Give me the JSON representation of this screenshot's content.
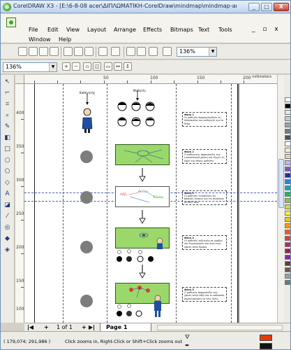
{
  "window": {
    "title": "CorelDRAW X3 - [E:\\6-8-08 acer\\ΔΙΠΛΩΜΑΤΙΚΗ-CorelDraw\\mindmap\\mindmap-anaparasta...",
    "min_label": "_",
    "max_label": "□",
    "close_label": "X"
  },
  "menu": {
    "file": "File",
    "edit": "Edit",
    "view": "View",
    "layout": "Layout",
    "arrange": "Arrange",
    "effects": "Effects",
    "bitmaps": "Bitmaps",
    "text": "Text",
    "tools": "Tools",
    "window": "Window",
    "help": "Help",
    "mdi": "_ ▫ x"
  },
  "toolbar": {
    "zoom_value": "136%"
  },
  "propbar": {
    "zoom_value": "136%"
  },
  "ruler": {
    "top_marks": [
      "50",
      "100",
      "150",
      "200"
    ],
    "unit": "millimeters",
    "left_marks": [
      "400",
      "350",
      "300",
      "250",
      "200",
      "150",
      "100"
    ],
    "left_unit": "millimeters"
  },
  "drawing": {
    "label_teacher": "Καθηγητής",
    "label_students": "Μαθητές",
    "notes": [
      {
        "title": "Φάση 1",
        "body": "Οι μαθητές παρακολουθούν τη διδασκαλία του καθηγητή για το θέμα"
      },
      {
        "title": "Φάση 2",
        "body": "Ο καθηγητής παρουσιάζει τον εννοιολογικό χάρτη και εξηγεί τη δομή του στους μαθητές"
      },
      {
        "title": "Φάση 3",
        "body": "Οι μαθητές εντοπίζουν τις βασικές έννοιες και τις συνδέουν μεταξύ τους"
      },
      {
        "title": "Φάση 4",
        "body": "Οι μαθητές συζητούν σε ομάδες και δημιουργούν τον δικό τους χάρτη στον πίνακα"
      },
      {
        "title": "Φάση 5",
        "body": "Ο μαθητής παρουσιάζει τον χάρτη στην τάξη και οι υπόλοιποι συμπληρώνουν με νέες ιδέες"
      }
    ],
    "board_words": [
      "Λέξη",
      "Ακτίνα",
      "Κύκλος"
    ]
  },
  "pagebar": {
    "first": "|◀",
    "prev": "+",
    "count": "1 of 1",
    "next": "+",
    "last": "▶|",
    "tab": "Page 1"
  },
  "status": {
    "coords": "( 179,074; 291,986 )",
    "hint": "Click zooms in, Right-Click or Shift+Click zooms out"
  },
  "colors": {
    "fill": "#e53a0e",
    "outline": "#111111",
    "board": "#9bd86b",
    "palette": [
      "#ffffff",
      "#000000",
      "#e6e6e6",
      "#c8c8c8",
      "#a0a0a0",
      "#787878",
      "#505050",
      "#ffffff",
      "#f7e9c8",
      "#e8d0a0",
      "#c8b4e6",
      "#7e57c2",
      "#2a2a9e",
      "#1e88e5",
      "#00acc1",
      "#00c853",
      "#8bc34a",
      "#cddc39",
      "#ffeb3b",
      "#ffc107",
      "#ff9800",
      "#ff5722",
      "#e53935",
      "#d81b60",
      "#ad1457",
      "#8e24aa",
      "#5d4037",
      "#795548",
      "#9e9e9e",
      "#607d8b"
    ]
  }
}
